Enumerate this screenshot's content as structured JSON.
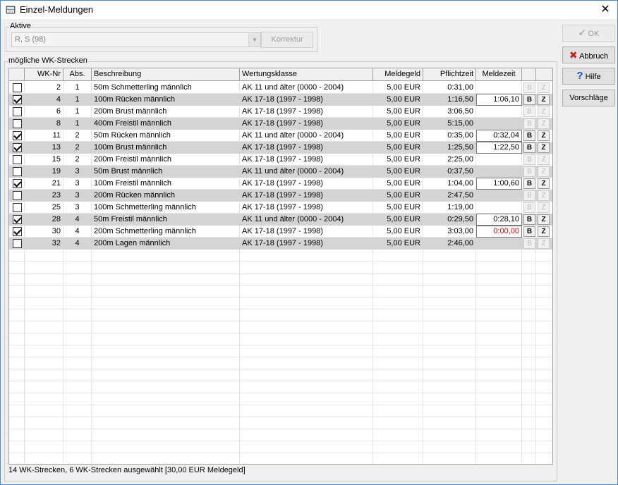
{
  "window": {
    "title": "Einzel-Meldungen",
    "close_symbol": "✕"
  },
  "aktive": {
    "legend": "Aktive",
    "selected": "R, S (98)",
    "korrektur_label": "Korrektur"
  },
  "side_buttons": {
    "ok": "OK",
    "abbruch": "Abbruch",
    "hilfe": "Hilfe",
    "vorschlaege": "Vorschläge"
  },
  "strecken": {
    "legend": "mögliche WK-Strecken",
    "headers": [
      "",
      "WK-Nr",
      "Abs.",
      "Beschreibung",
      "Wertungsklasse",
      "Meldegeld",
      "Pflichtzeit",
      "Meldezeit",
      "",
      ""
    ],
    "rows": [
      {
        "checked": false,
        "nr": "2",
        "abs": "1",
        "desc": "50m Schmetterling männlich",
        "klasse": "AK 11 und älter (0000 - 2004)",
        "geld": "5,00 EUR",
        "pflicht": "0:31,00",
        "meld": "",
        "meld_red": false,
        "active": false
      },
      {
        "checked": true,
        "nr": "4",
        "abs": "1",
        "desc": "100m Rücken männlich",
        "klasse": "AK 17-18 (1997 - 1998)",
        "geld": "5,00 EUR",
        "pflicht": "1:16,50",
        "meld": "1:06,10",
        "meld_red": false,
        "active": true
      },
      {
        "checked": false,
        "nr": "6",
        "abs": "1",
        "desc": "200m Brust männlich",
        "klasse": "AK 17-18 (1997 - 1998)",
        "geld": "5,00 EUR",
        "pflicht": "3:06,50",
        "meld": "",
        "meld_red": false,
        "active": false
      },
      {
        "checked": false,
        "nr": "8",
        "abs": "1",
        "desc": "400m Freistil männlich",
        "klasse": "AK 17-18 (1997 - 1998)",
        "geld": "5,00 EUR",
        "pflicht": "5:15,00",
        "meld": "",
        "meld_red": false,
        "active": false
      },
      {
        "checked": true,
        "nr": "11",
        "abs": "2",
        "desc": "50m Rücken männlich",
        "klasse": "AK 11 und älter (0000 - 2004)",
        "geld": "5,00 EUR",
        "pflicht": "0:35,00",
        "meld": "0:32,04",
        "meld_red": false,
        "active": true
      },
      {
        "checked": true,
        "nr": "13",
        "abs": "2",
        "desc": "100m Brust männlich",
        "klasse": "AK 17-18 (1997 - 1998)",
        "geld": "5,00 EUR",
        "pflicht": "1:25,50",
        "meld": "1:22,50",
        "meld_red": false,
        "active": true
      },
      {
        "checked": false,
        "nr": "15",
        "abs": "2",
        "desc": "200m Freistil männlich",
        "klasse": "AK 17-18 (1997 - 1998)",
        "geld": "5,00 EUR",
        "pflicht": "2:25,00",
        "meld": "",
        "meld_red": false,
        "active": false
      },
      {
        "checked": false,
        "nr": "19",
        "abs": "3",
        "desc": "50m Brust männlich",
        "klasse": "AK 11 und älter (0000 - 2004)",
        "geld": "5,00 EUR",
        "pflicht": "0:37,50",
        "meld": "",
        "meld_red": false,
        "active": false
      },
      {
        "checked": true,
        "nr": "21",
        "abs": "3",
        "desc": "100m Freistil männlich",
        "klasse": "AK 17-18 (1997 - 1998)",
        "geld": "5,00 EUR",
        "pflicht": "1:04,00",
        "meld": "1:00,60",
        "meld_red": false,
        "active": true
      },
      {
        "checked": false,
        "nr": "23",
        "abs": "3",
        "desc": "200m Rücken männlich",
        "klasse": "AK 17-18 (1997 - 1998)",
        "geld": "5,00 EUR",
        "pflicht": "2:47,50",
        "meld": "",
        "meld_red": false,
        "active": false
      },
      {
        "checked": false,
        "nr": "25",
        "abs": "3",
        "desc": "100m Schmetterling männlich",
        "klasse": "AK 17-18 (1997 - 1998)",
        "geld": "5,00 EUR",
        "pflicht": "1:19,00",
        "meld": "",
        "meld_red": false,
        "active": false
      },
      {
        "checked": true,
        "nr": "28",
        "abs": "4",
        "desc": "50m Freistil männlich",
        "klasse": "AK 11 und älter (0000 - 2004)",
        "geld": "5,00 EUR",
        "pflicht": "0:29,50",
        "meld": "0:28,10",
        "meld_red": false,
        "active": true
      },
      {
        "checked": true,
        "nr": "30",
        "abs": "4",
        "desc": "200m Schmetterling männlich",
        "klasse": "AK 17-18 (1997 - 1998)",
        "geld": "5,00 EUR",
        "pflicht": "3:03,00",
        "meld": "0:00,00",
        "meld_red": true,
        "active": true
      },
      {
        "checked": false,
        "nr": "32",
        "abs": "4",
        "desc": "200m Lagen männlich",
        "klasse": "AK 17-18 (1997 - 1998)",
        "geld": "5,00 EUR",
        "pflicht": "2:46,00",
        "meld": "",
        "meld_red": false,
        "active": false
      }
    ],
    "b_label": "B",
    "z_label": "Z"
  },
  "status": "14 WK-Strecken, 6 WK-Strecken ausgewählt [30,00 EUR Meldegeld]",
  "colors": {
    "alt_row": "#d4d4d4",
    "meld_red": "#d00000",
    "abbruch_x": "#c0281c",
    "hilfe_q": "#1f4fc4"
  }
}
